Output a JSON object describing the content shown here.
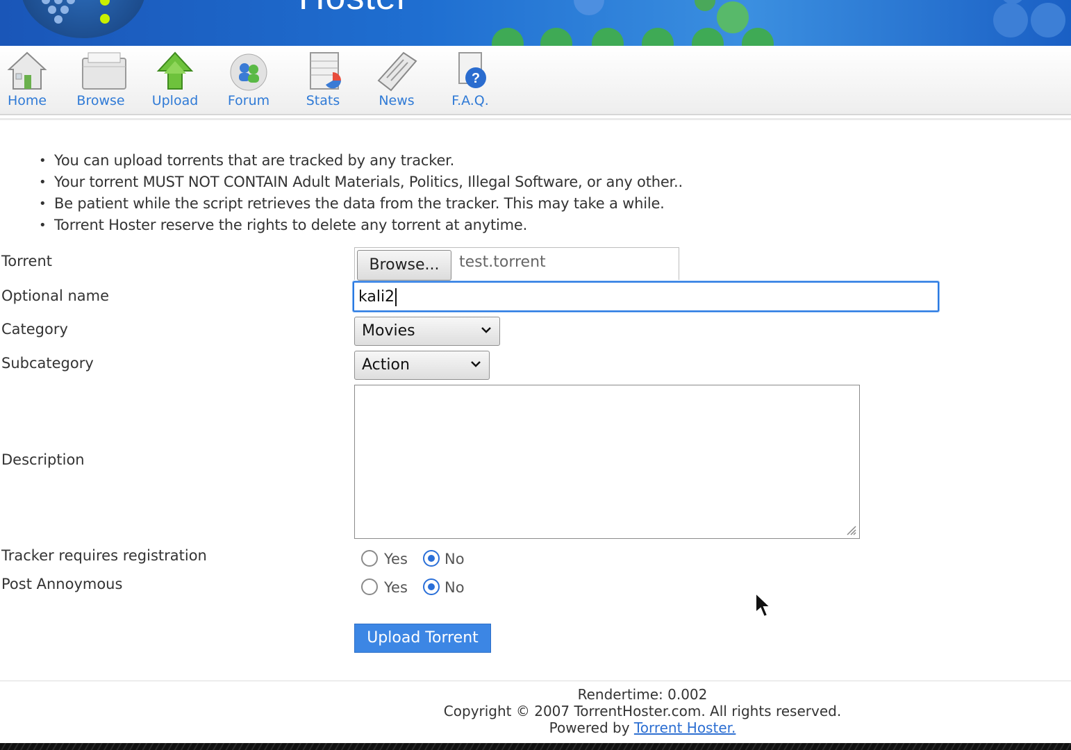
{
  "header": {
    "site_title": "Hoster"
  },
  "nav": {
    "items": [
      {
        "label": "Home",
        "icon": "home-icon"
      },
      {
        "label": "Browse",
        "icon": "folder-icon"
      },
      {
        "label": "Upload",
        "icon": "upload-arrow-icon"
      },
      {
        "label": "Forum",
        "icon": "forum-users-icon"
      },
      {
        "label": "Stats",
        "icon": "stats-chart-icon"
      },
      {
        "label": "News",
        "icon": "newspaper-icon"
      },
      {
        "label": "F.A.Q.",
        "icon": "help-document-icon"
      }
    ]
  },
  "rules": [
    "You can upload torrents that are tracked by any tracker.",
    "Your torrent MUST NOT CONTAIN Adult Materials, Politics, Illegal Software, or any other..",
    "Be patient while the script retrieves the data from the tracker. This may take a while.",
    "Torrent Hoster reserve the rights to delete any torrent at anytime."
  ],
  "form": {
    "torrent_label": "Torrent",
    "browse_button": "Browse...",
    "file_name": "test.torrent",
    "optional_name_label": "Optional name",
    "optional_name_value": "kali2",
    "category_label": "Category",
    "category_value": "Movies",
    "subcategory_label": "Subcategory",
    "subcategory_value": "Action",
    "description_label": "Description",
    "description_value": "",
    "tracker_reg_label": "Tracker requires registration",
    "post_anon_label": "Post Annoymous",
    "yes_label": "Yes",
    "no_label": "No",
    "tracker_reg_selected": "No",
    "post_anon_selected": "No",
    "submit_label": "Upload Torrent"
  },
  "footer": {
    "rendertime": "Rendertime: 0.002",
    "copyright": "Copyright © 2007 TorrentHoster.com. All rights reserved.",
    "powered_prefix": "Powered by",
    "powered_link": "Torrent Hoster."
  },
  "colors": {
    "banner": "#1f6fd1",
    "link": "#2f7ad6",
    "accent_button": "#3c86e4",
    "focus_border": "#2a7ae2"
  }
}
